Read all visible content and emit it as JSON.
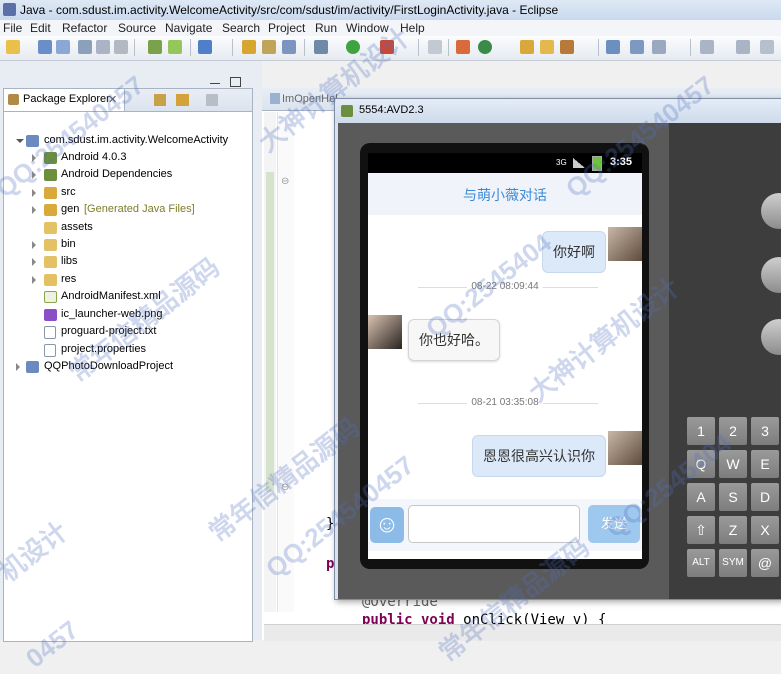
{
  "window": {
    "title": "Java - com.sdust.im.activity.WelcomeActivity/src/com/sdust/im/activity/FirstLoginActivity.java - Eclipse"
  },
  "menu": [
    "File",
    "Edit",
    "Refactor",
    "Source",
    "Navigate",
    "Search",
    "Project",
    "Run",
    "Window",
    "Help"
  ],
  "package_explorer": {
    "title": "Package Explorer",
    "tree": [
      {
        "label": "com.sdust.im.activity.WelcomeActivity",
        "note": ""
      },
      {
        "label": "Android 4.0.3",
        "note": ""
      },
      {
        "label": "Android Dependencies",
        "note": ""
      },
      {
        "label": "src",
        "note": ""
      },
      {
        "label": "gen",
        "note": "[Generated Java Files]"
      },
      {
        "label": "assets",
        "note": ""
      },
      {
        "label": "bin",
        "note": ""
      },
      {
        "label": "libs",
        "note": ""
      },
      {
        "label": "res",
        "note": ""
      },
      {
        "label": "AndroidManifest.xml",
        "note": ""
      },
      {
        "label": "ic_launcher-web.png",
        "note": ""
      },
      {
        "label": "proguard-project.txt",
        "note": ""
      },
      {
        "label": "project.properties",
        "note": ""
      },
      {
        "label": "QQPhotoDownloadProject",
        "note": ""
      }
    ]
  },
  "editor": {
    "tab": "ImOpenHel",
    "lines": [
      "}",
      "p",
      "@Override",
      "public void onClick(View v) {"
    ]
  },
  "emulator": {
    "title": "5554:AVD2.3",
    "status_time": "3:35",
    "status_network": "3G",
    "chat_title": "与萌小薇对话",
    "messages": [
      {
        "side": "right",
        "text": "你好啊"
      },
      {
        "side": "timestamp",
        "text": "08-22 08:09:44"
      },
      {
        "side": "left",
        "text": "你也好哈。"
      },
      {
        "side": "timestamp",
        "text": "08-21 03:35:08"
      },
      {
        "side": "right",
        "text": "恩恩很高兴认识你"
      }
    ],
    "input_value": "",
    "send_label": "发送",
    "keyboard": [
      [
        "1",
        "2",
        "3"
      ],
      [
        "Q",
        "W",
        "E"
      ],
      [
        "A",
        "S",
        "D"
      ],
      [
        "⇧",
        "Z",
        "X"
      ],
      [
        "ALT",
        "SYM",
        "@"
      ]
    ],
    "keyboard_superscripts": [
      "!",
      "@",
      "#"
    ]
  },
  "watermarks": [
    "QQ:254540457",
    "大神计算机设计",
    "常年信精品源码",
    "QQ:2545404",
    "大神计算机设计",
    "QQ:254540457",
    "常年信精品源码",
    "QQ:2545404",
    "机设计",
    "QQ:254540457",
    "常年信精品源码",
    "0457"
  ]
}
